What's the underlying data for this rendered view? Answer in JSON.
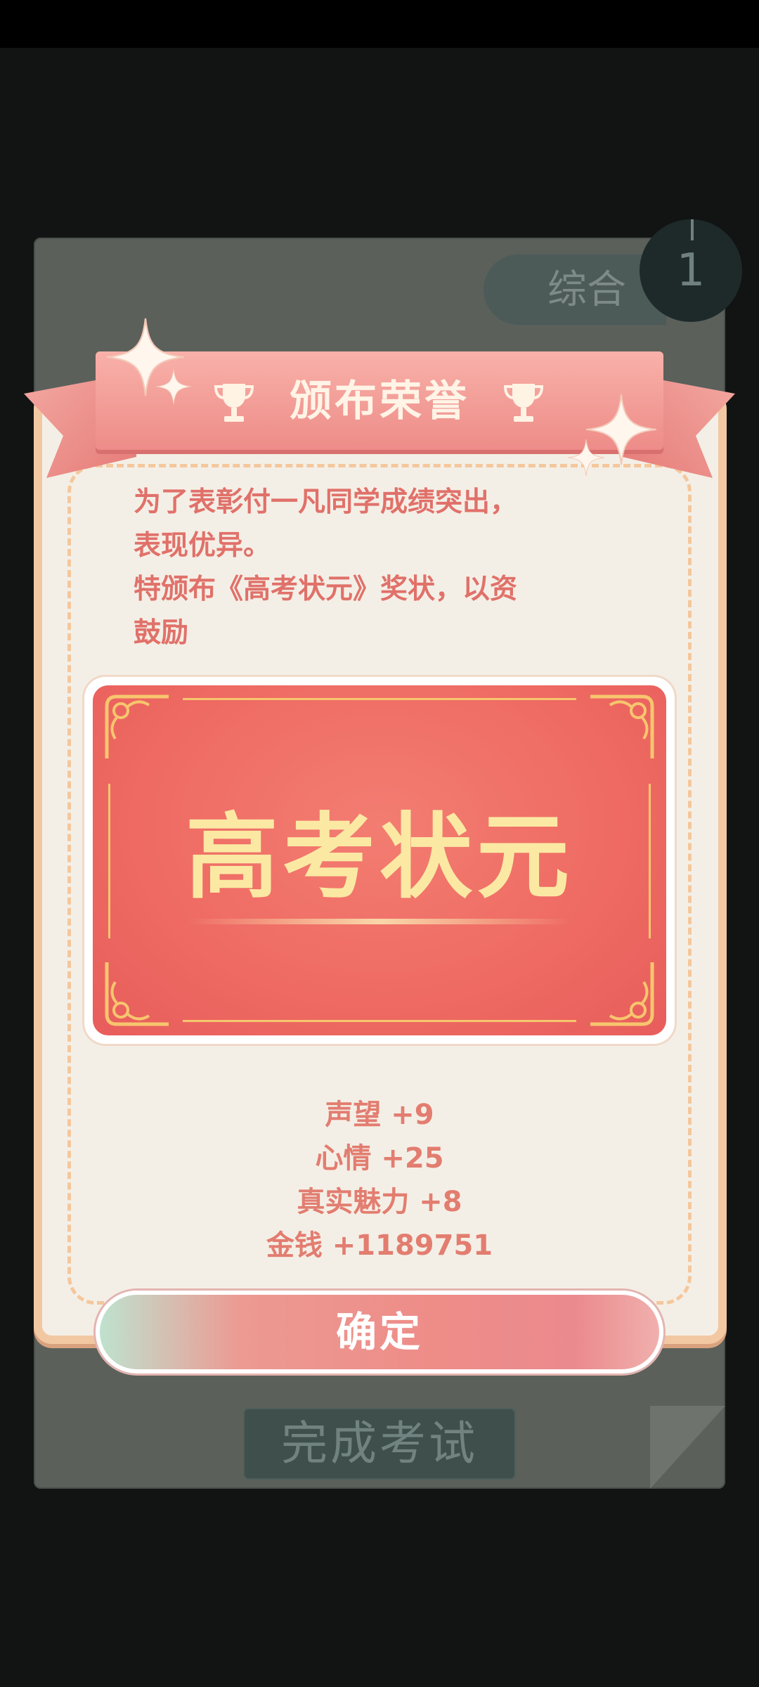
{
  "background": {
    "tab_label": "综合",
    "badge_number": "1",
    "finish_button_label": "完成考试"
  },
  "dialog": {
    "title": "颁布荣誉",
    "description": [
      "为了表彰付一凡同学成绩突出，",
      "表现优异。",
      "特颁布《高考状元》奖状，以资",
      "鼓励"
    ],
    "certificate_title": "高考状元",
    "rewards": [
      "声望 +9",
      "心情 +25",
      "真实魅力 +8",
      "金钱 +1189751"
    ],
    "confirm_label": "确定"
  },
  "colors": {
    "accent": "#ee8c88",
    "certificate": "#ee6a62",
    "gold": "#fbe9a3",
    "text_pink": "#e0716a"
  },
  "icons": [
    "trophy-icon",
    "sparkle-icon",
    "ornament-corner-icon"
  ]
}
